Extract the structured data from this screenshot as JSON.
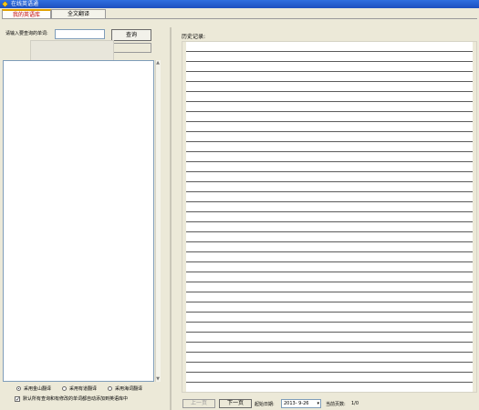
{
  "window": {
    "title": "在线英语通"
  },
  "tabs": [
    {
      "label": "我的英语库"
    },
    {
      "label": "全文翻译"
    }
  ],
  "query": {
    "label": "请输入要查询的单词:",
    "value": "",
    "lookup_label": "查询"
  },
  "options": {
    "radios": [
      {
        "label": "采用金山翻译",
        "selected": true
      },
      {
        "label": "采用有道翻译",
        "selected": false
      },
      {
        "label": "采用海词翻译",
        "selected": false
      }
    ],
    "auto_add_label": "默认所有查询和有修改的单词都自动添加到英语库中",
    "auto_add_checked": true
  },
  "history": {
    "label": "历史记录:"
  },
  "nav": {
    "prev_label": "上一页",
    "next_label": "下一页",
    "start_date_label": "起始日期:",
    "start_date_value": "2013- 9-26",
    "page_count_label": "当前页数:",
    "page_count_value": "1/0"
  },
  "icons": {
    "app": "app-icon",
    "dropdown": "chevron-down-icon"
  },
  "colors": {
    "titlebar": "#1d4fbf",
    "active_tab_text": "#c00000",
    "background": "#ece9d8"
  }
}
